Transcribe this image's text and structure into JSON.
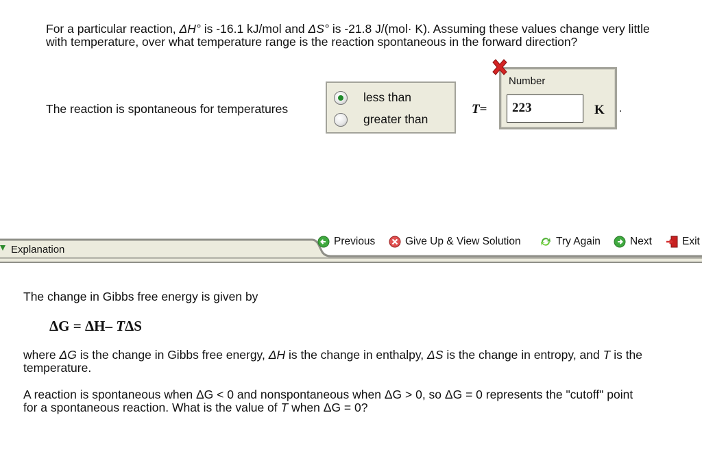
{
  "question": {
    "line1_pre": "For a particular reaction, ",
    "dH": "ΔH°",
    "line1_mid": " is -16.1 kJ/mol and ",
    "dS": "ΔS°",
    "line1_post": " is -21.8 J/(mol· K). Assuming these values change very little with temperature, over what temperature range is the reaction spontaneous in the forward direction?"
  },
  "answer": {
    "prompt": "The reaction is spontaneous for temperatures",
    "options": [
      {
        "label": "less than",
        "selected": true
      },
      {
        "label": "greater than",
        "selected": false
      }
    ],
    "t_symbol": "T",
    "equals": "=",
    "number_label": "Number",
    "value": "223",
    "unit": "K",
    "trailing": ".",
    "status_icon": "incorrect-x-icon"
  },
  "toolbar": {
    "explanation_label": "Explanation",
    "buttons": [
      {
        "label": "Previous",
        "icon": "arrow-left-icon"
      },
      {
        "label": "Give Up & View Solution",
        "icon": "give-up-icon"
      },
      {
        "label": "Try Again",
        "icon": "refresh-icon"
      },
      {
        "label": "Next",
        "icon": "arrow-right-icon"
      },
      {
        "label": "Exit",
        "icon": "exit-door-icon"
      }
    ]
  },
  "explanation": {
    "intro": "The change in Gibbs free energy is given by",
    "formula": {
      "dG": "ΔG",
      "eq": "=",
      "dH": "ΔH",
      "minus": "–",
      "T": "T",
      "dS": "ΔS"
    },
    "para1": {
      "s1": "where ",
      "v1": "ΔG",
      "s2": " is the change in Gibbs free energy, ",
      "v2": "ΔH",
      "s3": " is the change in enthalpy, ",
      "v3": "ΔS",
      "s4": " is the change in entropy, and ",
      "v4": "T",
      "s5": " is the temperature."
    },
    "para2": {
      "s1": "A reaction is spontaneous when ΔG < 0  and nonspontaneous when ΔG > 0, so ΔG = 0 represents the \"cutoff\" point for a spontaneous reaction. What is the value of ",
      "v1": "T",
      "s2": " when ΔG = 0?"
    }
  }
}
